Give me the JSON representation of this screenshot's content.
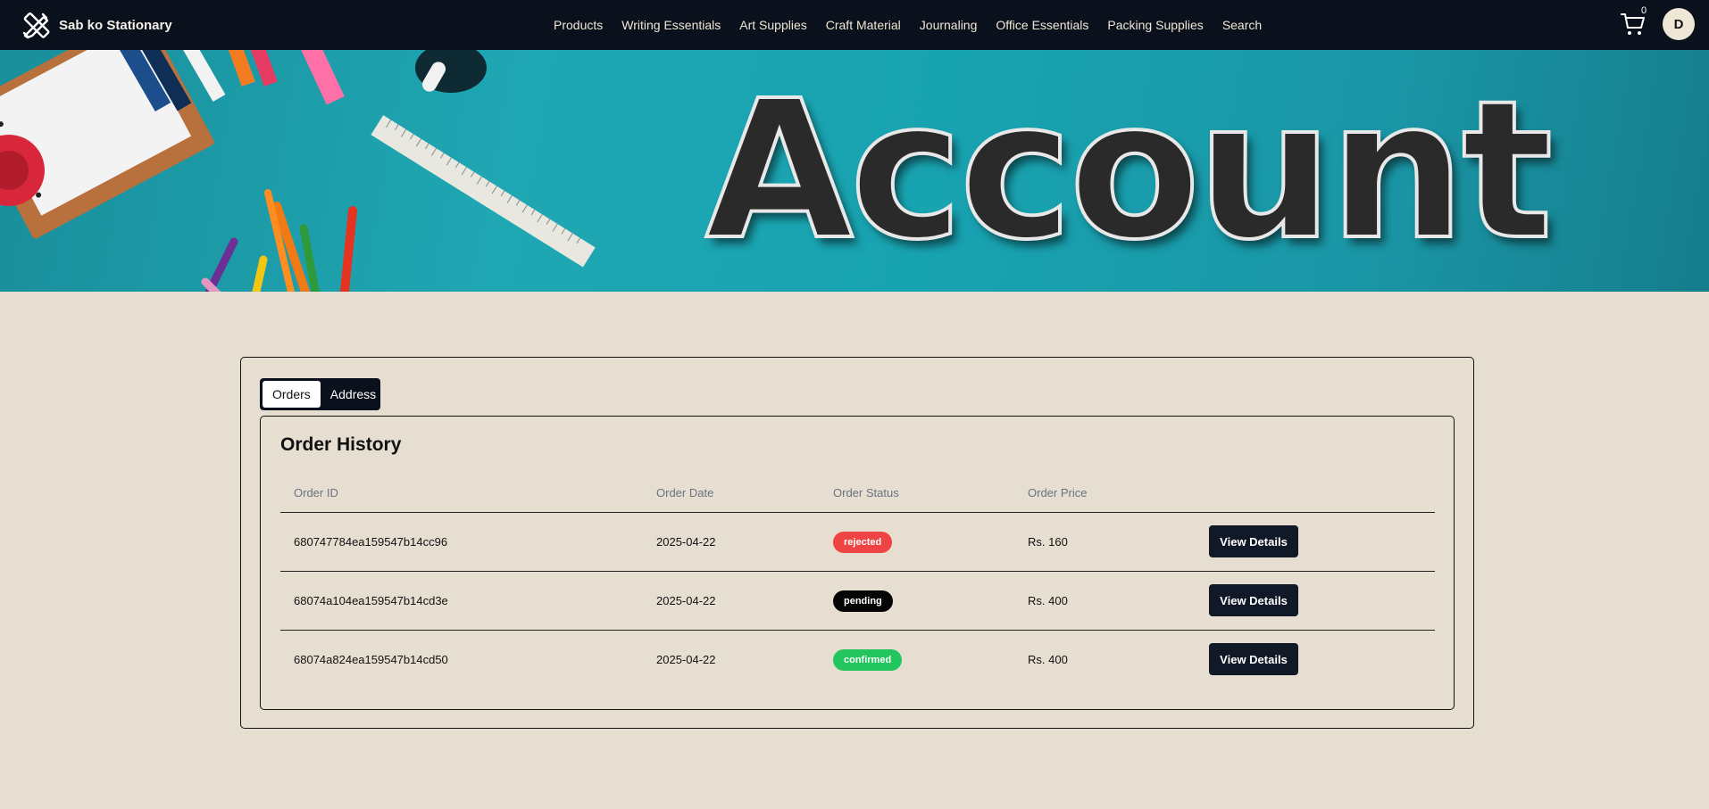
{
  "navbar": {
    "brand": "Sab ko Stationary",
    "links": [
      "Products",
      "Writing Essentials",
      "Art Supplies",
      "Craft Material",
      "Journaling",
      "Office Essentials",
      "Packing Supplies",
      "Search"
    ],
    "cart_count": "0",
    "avatar_initial": "D"
  },
  "banner": {
    "title": "Account"
  },
  "tabs": {
    "orders": "Orders",
    "address": "Address",
    "active": "orders"
  },
  "history": {
    "title": "Order History",
    "columns": [
      "Order ID",
      "Order Date",
      "Order Status",
      "Order Price"
    ],
    "rows": [
      {
        "id": "680747784ea159547b14cc96",
        "date": "2025-04-22",
        "status": "rejected",
        "price": "Rs. 160",
        "action": "View Details"
      },
      {
        "id": "68074a104ea159547b14cd3e",
        "date": "2025-04-22",
        "status": "pending",
        "price": "Rs. 400",
        "action": "View Details"
      },
      {
        "id": "68074a824ea159547b14cd50",
        "date": "2025-04-22",
        "status": "confirmed",
        "price": "Rs. 400",
        "action": "View Details"
      }
    ]
  },
  "colors": {
    "navbar_bg": "#0b111c",
    "page_bg": "#e6dfd1",
    "rejected": "#ef4444",
    "pending": "#050505",
    "confirmed": "#22c55e",
    "button_bg": "#111827"
  },
  "icons": {
    "logo": "pencil-ruler-icon",
    "cart": "shopping-cart-icon"
  }
}
